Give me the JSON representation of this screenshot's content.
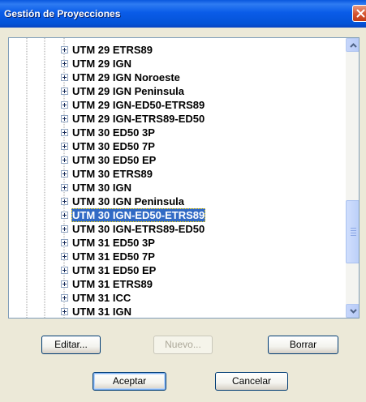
{
  "window": {
    "title": "Gestión de Proyecciones"
  },
  "tree": {
    "items": [
      "UTM 29 ETRS89",
      "UTM 29 IGN",
      "UTM 29 IGN Noroeste",
      "UTM 29 IGN Peninsula",
      "UTM 29 IGN-ED50-ETRS89",
      "UTM 29 IGN-ETRS89-ED50",
      "UTM 30 ED50 3P",
      "UTM 30 ED50 7P",
      "UTM 30 ED50 EP",
      "UTM 30 ETRS89",
      "UTM 30 IGN",
      "UTM 30 IGN Peninsula",
      "UTM 30 IGN-ED50-ETRS89",
      "UTM 30 IGN-ETRS89-ED50",
      "UTM 31 ED50 3P",
      "UTM 31 ED50 7P",
      "UTM 31 ED50 EP",
      "UTM 31 ETRS89",
      "UTM 31 ICC",
      "UTM 31 IGN"
    ],
    "selected_index": 12
  },
  "buttons": {
    "edit": "Editar...",
    "new": "Nuevo...",
    "delete": "Borrar",
    "accept": "Aceptar",
    "cancel": "Cancelar"
  }
}
